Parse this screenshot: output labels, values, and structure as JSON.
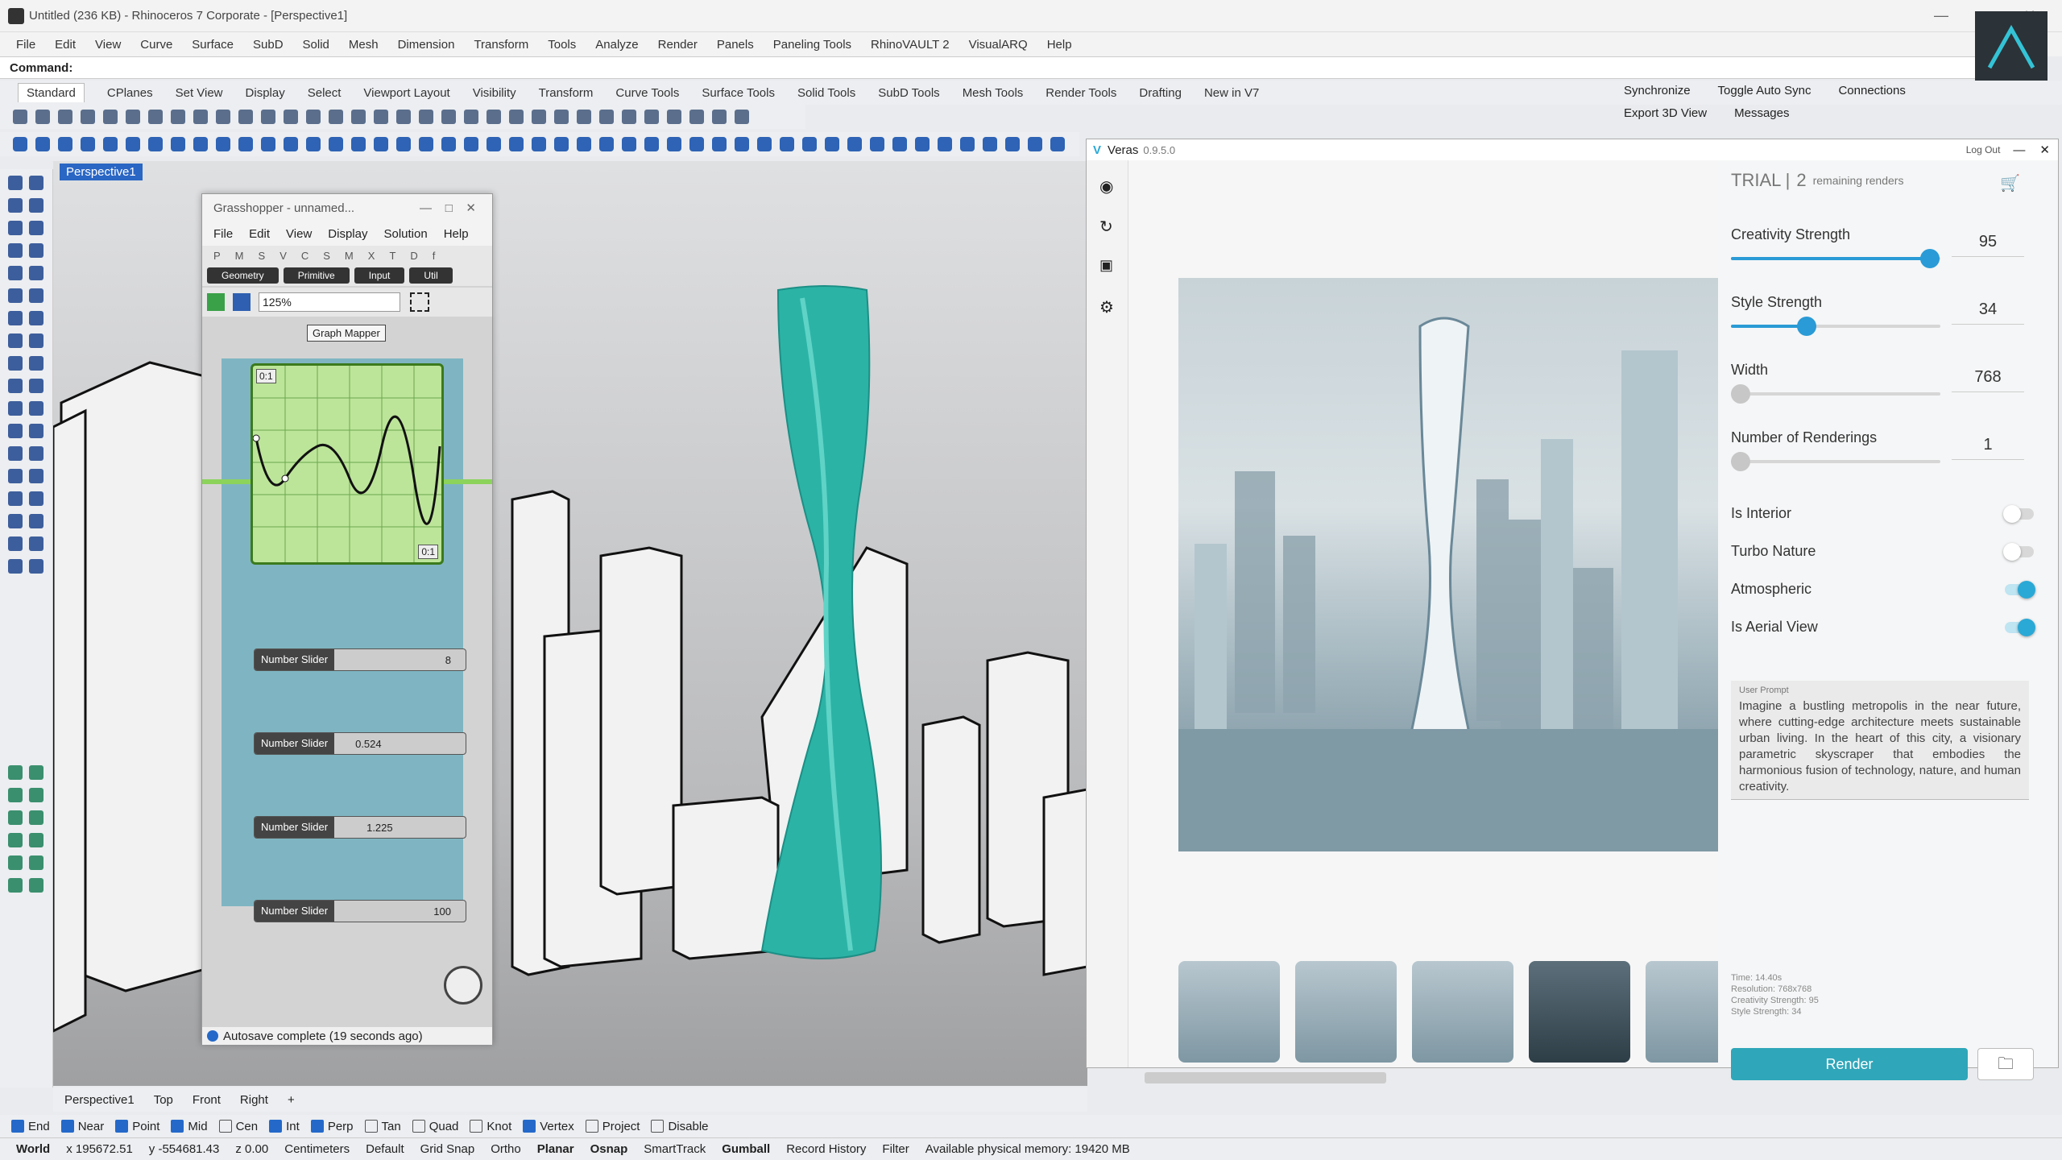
{
  "window": {
    "title": "Untitled (236 KB) - Rhinoceros 7 Corporate - [Perspective1]"
  },
  "menu": [
    "File",
    "Edit",
    "View",
    "Curve",
    "Surface",
    "SubD",
    "Solid",
    "Mesh",
    "Dimension",
    "Transform",
    "Tools",
    "Analyze",
    "Render",
    "Panels",
    "Paneling Tools",
    "RhinoVAULT 2",
    "VisualARQ",
    "Help"
  ],
  "command": {
    "label": "Command:"
  },
  "toolbar_tabs": [
    "Standard",
    "CPlanes",
    "Set View",
    "Display",
    "Select",
    "Viewport Layout",
    "Visibility",
    "Transform",
    "Curve Tools",
    "Surface Tools",
    "Solid Tools",
    "SubD Tools",
    "Mesh Tools",
    "Render Tools",
    "Drafting",
    "New in V7"
  ],
  "right_tools": {
    "sync": "Synchronize",
    "toggle": "Toggle Auto Sync",
    "connections": "Connections",
    "export": "Export 3D View",
    "messages": "Messages"
  },
  "viewport": {
    "label": "Perspective1"
  },
  "viewport_tabs": [
    "Perspective1",
    "Top",
    "Front",
    "Right"
  ],
  "osnaps": [
    {
      "label": "End",
      "on": true
    },
    {
      "label": "Near",
      "on": true
    },
    {
      "label": "Point",
      "on": true
    },
    {
      "label": "Mid",
      "on": true
    },
    {
      "label": "Cen",
      "on": false
    },
    {
      "label": "Int",
      "on": true
    },
    {
      "label": "Perp",
      "on": true
    },
    {
      "label": "Tan",
      "on": false
    },
    {
      "label": "Quad",
      "on": false
    },
    {
      "label": "Knot",
      "on": false
    },
    {
      "label": "Vertex",
      "on": true
    },
    {
      "label": "Project",
      "on": false
    },
    {
      "label": "Disable",
      "on": false
    }
  ],
  "status": {
    "cplane": "World",
    "x": "x 195672.51",
    "y": "y -554681.43",
    "z": "z 0.00",
    "units": "Centimeters",
    "layer": "Default",
    "grid": "Grid Snap",
    "ortho": "Ortho",
    "planar": "Planar",
    "osnap": "Osnap",
    "smarttrack": "SmartTrack",
    "gumball": "Gumball",
    "record": "Record History",
    "filter": "Filter",
    "memory": "Available physical memory: 19420 MB"
  },
  "grasshopper": {
    "title": "Grasshopper - unnamed...",
    "menu": [
      "File",
      "Edit",
      "View",
      "Display",
      "Solution",
      "Help"
    ],
    "tabs": [
      "P",
      "M",
      "S",
      "V",
      "C",
      "S",
      "M",
      "X",
      "T",
      "D",
      "f"
    ],
    "categories": [
      "Geometry",
      "Primitive",
      "Input",
      "Util"
    ],
    "zoom": "125%",
    "graph_mapper": {
      "label": "Graph Mapper",
      "corner_tl": "0:1",
      "corner_br": "0:1"
    },
    "sliders": [
      {
        "label": "Number Slider",
        "value": "8"
      },
      {
        "label": "Number Slider",
        "value": "0.524"
      },
      {
        "label": "Number Slider",
        "value": "1.225"
      },
      {
        "label": "Number Slider",
        "value": "100"
      }
    ],
    "footer": "Autosave complete (19 seconds ago)"
  },
  "veras": {
    "title": "Veras",
    "version": "0.9.5.0",
    "logout": "Log Out",
    "trial": "TRIAL |",
    "remaining_count": "2",
    "remaining_label": "remaining renders",
    "creativity": {
      "label": "Creativity Strength",
      "value": "95"
    },
    "style": {
      "label": "Style Strength",
      "value": "34"
    },
    "width": {
      "label": "Width",
      "value": "768"
    },
    "renderings": {
      "label": "Number of Renderings",
      "value": "1"
    },
    "toggles": [
      {
        "label": "Is Interior",
        "on": false
      },
      {
        "label": "Turbo Nature",
        "on": false
      },
      {
        "label": "Atmospheric",
        "on": true
      },
      {
        "label": "Is Aerial View",
        "on": true
      }
    ],
    "prompt": {
      "label": "User Prompt",
      "text": "Imagine a bustling metropolis in the near future, where cutting-edge architecture meets sustainable urban living. In the heart of this city, a visionary parametric skyscraper that embodies the harmonious fusion of technology, nature, and human creativity."
    },
    "info": [
      "Time: 14.40s",
      "Resolution: 768x768",
      "Creativity Strength: 95",
      "Style Strength: 34"
    ],
    "render_button": "Render"
  }
}
